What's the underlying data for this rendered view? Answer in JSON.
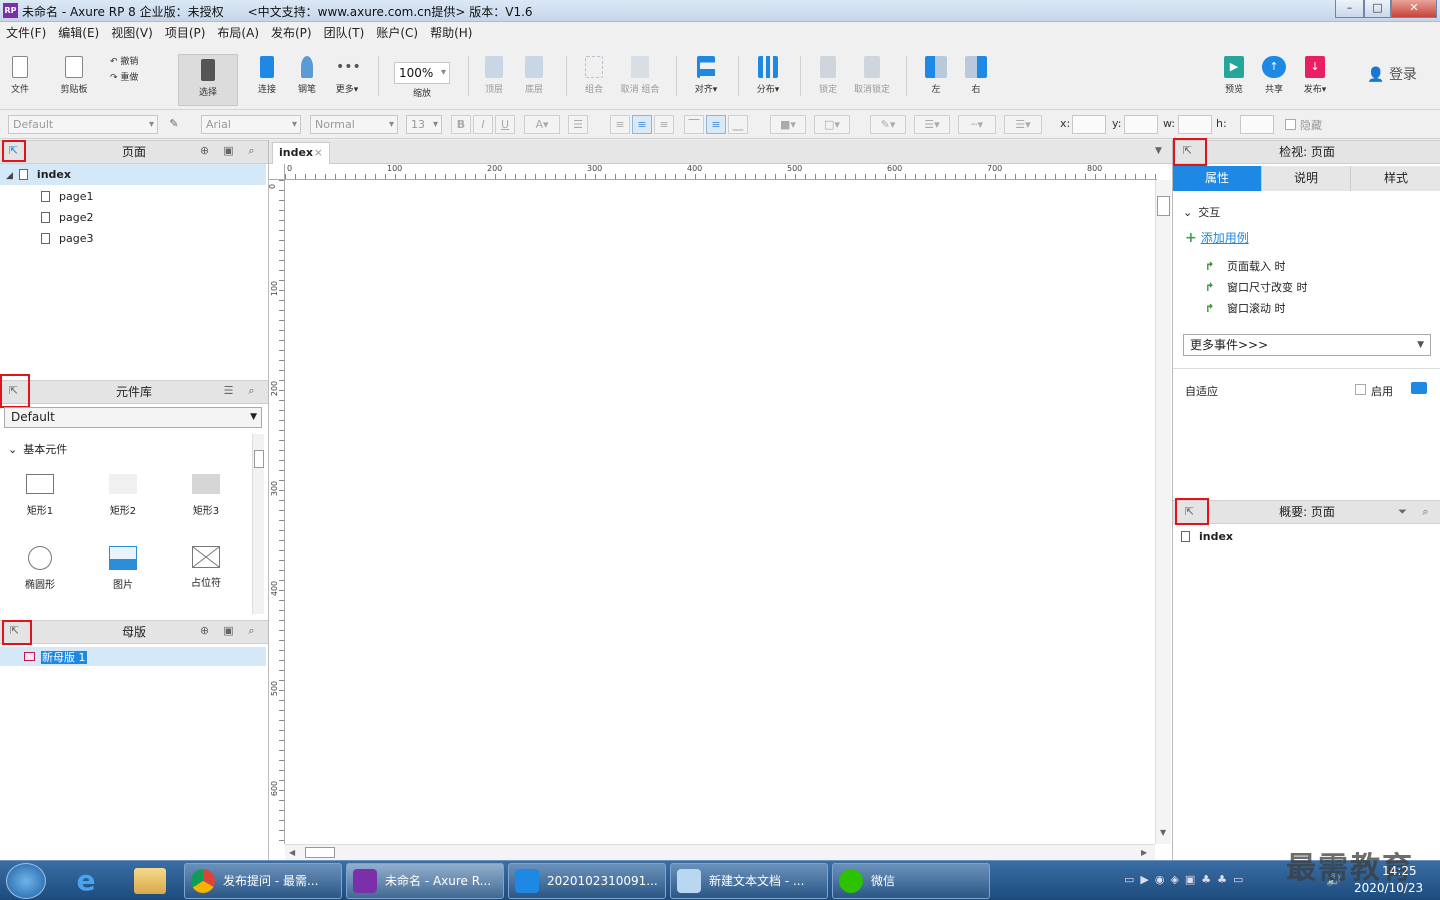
{
  "window": {
    "title": "未命名 - Axure RP 8 企业版：未授权　　<中文支持：www.axure.com.cn提供> 版本：V1.6",
    "app_icon": "RP"
  },
  "menu": [
    "文件(F)",
    "编辑(E)",
    "视图(V)",
    "项目(P)",
    "布局(A)",
    "发布(P)",
    "团队(T)",
    "账户(C)",
    "帮助(H)"
  ],
  "toolbar": {
    "file": "文件",
    "clipboard": "剪贴板",
    "undo": "撤销",
    "redo": "重做",
    "select": "选择",
    "connect": "连接",
    "pen": "钢笔",
    "more": "更多▾",
    "zoom_value": "100%",
    "zoom": "缩放",
    "top": "顶层",
    "bottom": "底层",
    "group": "组合",
    "ungroup": "取消 组合",
    "align": "对齐▾",
    "distribute": "分布▾",
    "lock": "锁定",
    "unlock": "取消锁定",
    "left": "左",
    "right": "右",
    "preview": "预览",
    "share": "共享",
    "publish": "发布▾",
    "login": "登录"
  },
  "format": {
    "style": "Default",
    "font": "Arial",
    "weight": "Normal",
    "size": "13",
    "x": "x:",
    "y": "y:",
    "w": "w:",
    "h": "h:",
    "hide": "隐藏"
  },
  "pages_panel": {
    "title": "页面",
    "root": "index",
    "children": [
      "page1",
      "page2",
      "page3"
    ]
  },
  "library_panel": {
    "title": "元件库",
    "selected": "Default",
    "section": "基本元件",
    "widgets": [
      "矩形1",
      "矩形2",
      "矩形3",
      "椭圆形",
      "图片",
      "占位符"
    ]
  },
  "masters_panel": {
    "title": "母版",
    "item": "新母版 1"
  },
  "canvas": {
    "tab": "index",
    "tab_close": "×",
    "ruler_h": [
      "0",
      "100",
      "200",
      "300",
      "400",
      "500",
      "600",
      "700",
      "800"
    ],
    "ruler_v": [
      "0",
      "100",
      "200",
      "300",
      "400",
      "500",
      "600"
    ]
  },
  "inspector": {
    "title": "检视: 页面",
    "tabs": [
      "属性",
      "说明",
      "样式"
    ],
    "section": "交互",
    "add_case": "添加用例",
    "events": [
      "页面载入 时",
      "窗口尺寸改变 时",
      "窗口滚动 时"
    ],
    "more_events": "更多事件>>>",
    "adaptive": "自适应",
    "enable": "启用"
  },
  "outline": {
    "title": "概要: 页面",
    "item": "index"
  },
  "taskbar": {
    "tasks": [
      "发布提问 - 最需...",
      "未命名 - Axure R...",
      "2020102310091...",
      "新建文本文档 - ...",
      "微信"
    ],
    "time": "14:25",
    "date": "2020/10/23",
    "watermark": "最需教育"
  },
  "colors": {
    "accent": "#1e88e5",
    "red_highlight": "#e0151b",
    "task_blue": "#2a5d93"
  }
}
